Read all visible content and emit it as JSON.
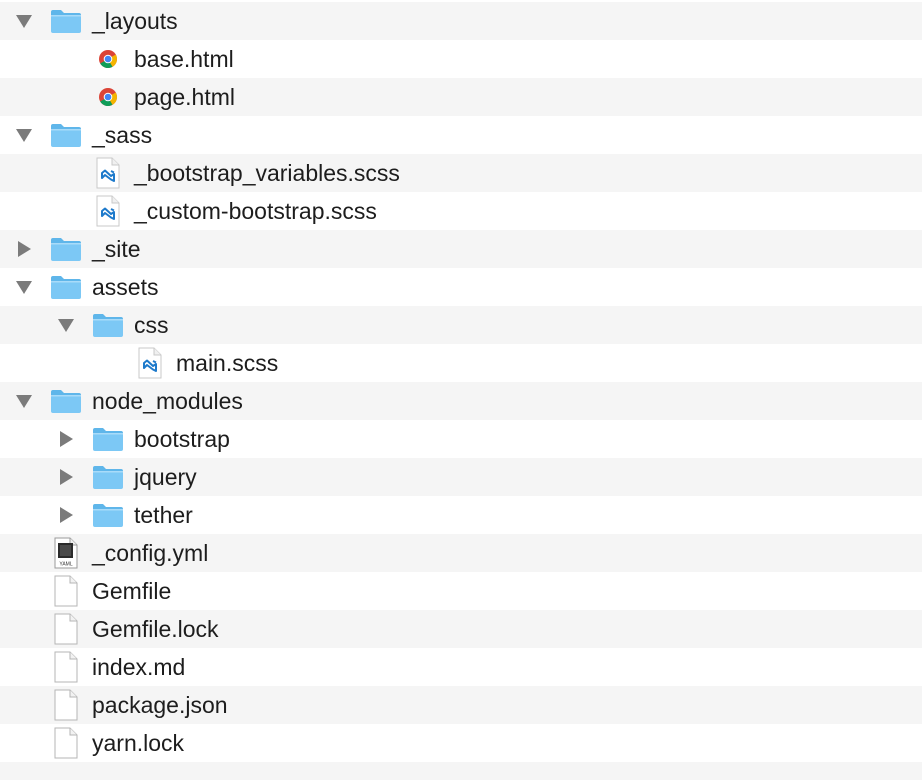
{
  "rows": [
    {
      "label": "_layouts",
      "depth": 0,
      "kind": "folder",
      "disclosure": "expanded",
      "icon": "folder-icon"
    },
    {
      "label": "base.html",
      "depth": 1,
      "kind": "file",
      "disclosure": "none",
      "icon": "chrome-icon"
    },
    {
      "label": "page.html",
      "depth": 1,
      "kind": "file",
      "disclosure": "none",
      "icon": "chrome-icon"
    },
    {
      "label": "_sass",
      "depth": 0,
      "kind": "folder",
      "disclosure": "expanded",
      "icon": "folder-icon"
    },
    {
      "label": "_bootstrap_variables.scss",
      "depth": 1,
      "kind": "file",
      "disclosure": "none",
      "icon": "vscode-icon"
    },
    {
      "label": "_custom-bootstrap.scss",
      "depth": 1,
      "kind": "file",
      "disclosure": "none",
      "icon": "vscode-icon"
    },
    {
      "label": "_site",
      "depth": 0,
      "kind": "folder",
      "disclosure": "collapsed",
      "icon": "folder-icon"
    },
    {
      "label": "assets",
      "depth": 0,
      "kind": "folder",
      "disclosure": "expanded",
      "icon": "folder-icon"
    },
    {
      "label": "css",
      "depth": 1,
      "kind": "folder",
      "disclosure": "expanded",
      "icon": "folder-icon"
    },
    {
      "label": "main.scss",
      "depth": 2,
      "kind": "file",
      "disclosure": "none",
      "icon": "vscode-icon"
    },
    {
      "label": "node_modules",
      "depth": 0,
      "kind": "folder",
      "disclosure": "expanded",
      "icon": "folder-icon"
    },
    {
      "label": "bootstrap",
      "depth": 1,
      "kind": "folder",
      "disclosure": "collapsed",
      "icon": "folder-icon"
    },
    {
      "label": "jquery",
      "depth": 1,
      "kind": "folder",
      "disclosure": "collapsed",
      "icon": "folder-icon"
    },
    {
      "label": "tether",
      "depth": 1,
      "kind": "folder",
      "disclosure": "collapsed",
      "icon": "folder-icon"
    },
    {
      "label": "_config.yml",
      "depth": 0,
      "kind": "file",
      "disclosure": "none",
      "icon": "yaml-file-icon",
      "badge": "YAML"
    },
    {
      "label": "Gemfile",
      "depth": 0,
      "kind": "file",
      "disclosure": "none",
      "icon": "document-icon"
    },
    {
      "label": "Gemfile.lock",
      "depth": 0,
      "kind": "file",
      "disclosure": "none",
      "icon": "document-icon"
    },
    {
      "label": "index.md",
      "depth": 0,
      "kind": "file",
      "disclosure": "none",
      "icon": "document-icon"
    },
    {
      "label": "package.json",
      "depth": 0,
      "kind": "file",
      "disclosure": "none",
      "icon": "document-icon"
    },
    {
      "label": "yarn.lock",
      "depth": 0,
      "kind": "file",
      "disclosure": "none",
      "icon": "document-icon"
    },
    {
      "label": "",
      "depth": 0,
      "kind": "empty",
      "disclosure": "none",
      "icon": ""
    }
  ],
  "colors": {
    "stripe": "#f5f5f5",
    "folder": "#7cc8f5",
    "folder_tab": "#5fb6ea",
    "disclosure": "#7b7b7b",
    "vscode_blue": "#1e7acb"
  }
}
